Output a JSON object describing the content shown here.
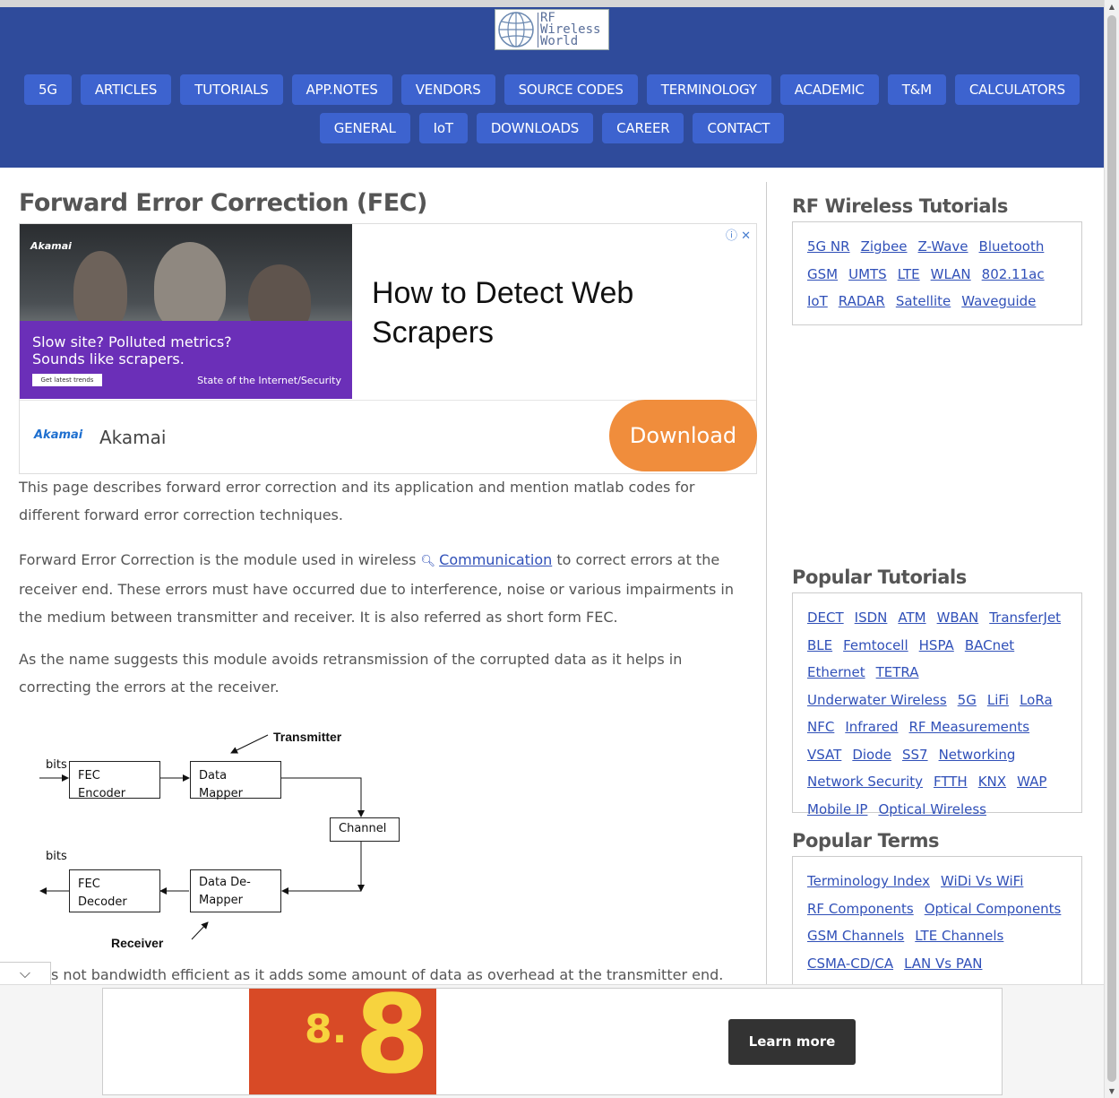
{
  "site": {
    "logo_text": [
      "RF",
      "Wireless",
      "World"
    ]
  },
  "nav": {
    "row1": [
      "5G",
      "ARTICLES",
      "TUTORIALS",
      "APP.NOTES",
      "VENDORS",
      "SOURCE CODES",
      "TERMINOLOGY",
      "ACADEMIC",
      "T&M",
      "CALCULATORS"
    ],
    "row2": [
      "GENERAL",
      "IoT",
      "DOWNLOADS",
      "CAREER",
      "CONTACT"
    ]
  },
  "article": {
    "title": "Forward Error Correction (FEC)",
    "p1": "This page describes forward error correction and its application and mention matlab codes for different forward error correction techniques.",
    "p2_before": "Forward Error Correction is the module used in wireless ",
    "p2_link": "Communication",
    "p2_after": " to correct errors at the receiver end. These errors must have occurred due to interference, noise or various impairments in the medium between transmitter and receiver. It is also referred as short form FEC.",
    "p3": "As the name suggests this module avoids retransmission of the corrupted data as it helps in correcting the errors at the receiver.",
    "p4_partial": "s not bandwidth efficient as it adds some amount of data as overhead at the transmitter end."
  },
  "diagram": {
    "transmitter": "Transmitter",
    "receiver": "Receiver",
    "bits_in": "bits",
    "bits_out": "bits",
    "fec_encoder": "FEC Encoder",
    "data_mapper": "Data Mapper",
    "channel": "Channel",
    "fec_decoder": "FEC Decoder",
    "data_demapper": "Data De-\nMapper"
  },
  "ad": {
    "brand_small": "Akamai",
    "image_text": "Slow site? Polluted metrics?\nSounds like scrapers.",
    "image_cta": "Get latest trends",
    "image_footer": "State of the Internet/Security",
    "headline": "How to Detect Web Scrapers",
    "brand_logo": "Akamai",
    "brand_name": "Akamai",
    "button": "Download",
    "close_icons": "ⓘ ✕"
  },
  "sidebar": {
    "rf_tutorials": {
      "title": "RF Wireless Tutorials",
      "links": [
        "5G NR",
        "Zigbee",
        "Z-Wave",
        "Bluetooth",
        "GSM",
        "UMTS",
        "LTE",
        "WLAN",
        "802.11ac",
        "IoT",
        "RADAR",
        "Satellite",
        "Waveguide"
      ]
    },
    "popular_tutorials": {
      "title": "Popular Tutorials",
      "links": [
        "DECT",
        "ISDN",
        "ATM",
        "WBAN",
        "TransferJet",
        "BLE",
        "Femtocell",
        "HSPA",
        "BACnet",
        "Ethernet",
        "TETRA",
        "Underwater Wireless",
        "5G",
        "LiFi",
        "LoRa",
        "NFC",
        "Infrared",
        "RF Measurements",
        "VSAT",
        "Diode",
        "SS7",
        "Networking",
        "Network Security",
        "FTTH",
        "KNX",
        "WAP",
        "Mobile IP",
        "Optical Wireless"
      ]
    },
    "popular_terms": {
      "title": "Popular Terms",
      "links": [
        "Terminology Index",
        "WiDi Vs WiFi",
        "RF Components",
        "Optical Components",
        "GSM Channels",
        "LTE Channels",
        "CSMA-CD/CA",
        "LAN Vs PAN"
      ]
    }
  },
  "bottom_ad": {
    "number_small": "8.",
    "number_big": "8",
    "button": "Learn more"
  },
  "colors": {
    "header_bg": "#2f4b9b",
    "nav_button": "#3d63cf",
    "link": "#3050b8",
    "ad_button": "#f08d3c"
  }
}
